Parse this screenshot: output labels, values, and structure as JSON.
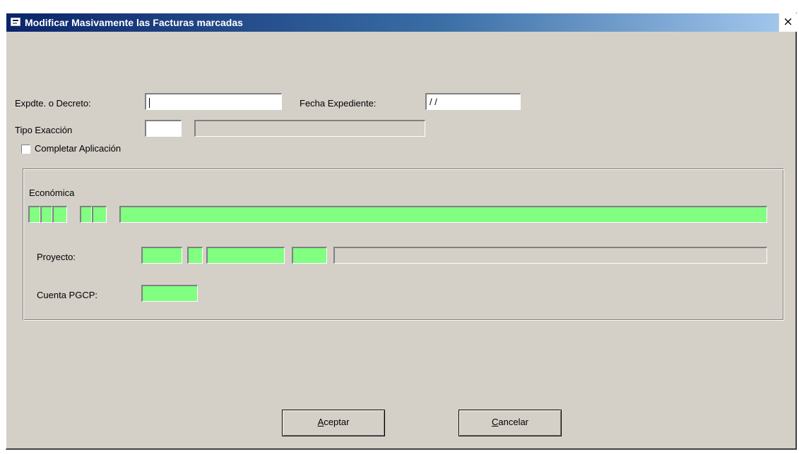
{
  "window": {
    "title": "Modificar Masivamente las Facturas marcadas",
    "close_label": "×"
  },
  "form": {
    "expediente_label": "Expdte. o Decreto:",
    "expediente_value": "",
    "fecha_label": "Fecha Expediente:",
    "fecha_value": "/ /",
    "tipo_label": "Tipo Exacción",
    "tipo_code": "",
    "tipo_desc": "",
    "completar_label": "Completar Aplicación",
    "completar_checked": false
  },
  "group": {
    "economica_label": "Económica",
    "proyecto_label": "Proyecto:",
    "cuenta_label": "Cuenta PGCP:"
  },
  "buttons": {
    "aceptar_hotkey": "A",
    "aceptar_rest": "ceptar",
    "cancelar_hotkey": "C",
    "cancelar_rest": "ancelar"
  },
  "colors": {
    "dialog_bg": "#d4d0c8",
    "field_green": "#80ff80",
    "title_dark": "#0a246a"
  }
}
